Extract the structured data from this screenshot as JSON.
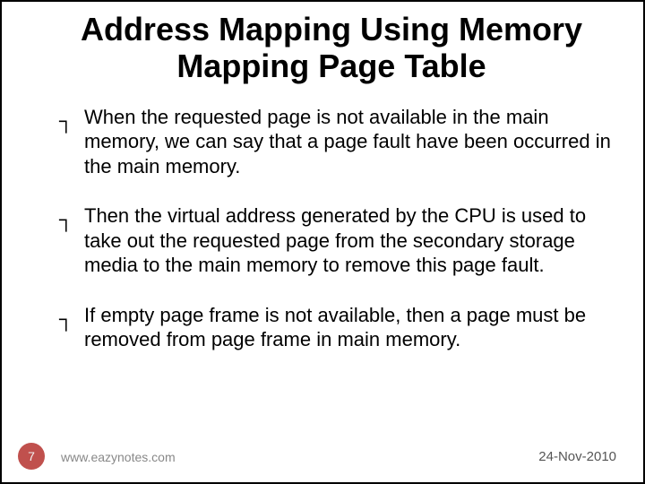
{
  "title": "Address Mapping Using Memory Mapping Page Table",
  "bullet_glyph": "┐",
  "bullets": [
    "When the requested page is not available in the main memory, we can say that a page fault have been occurred in the main memory.",
    "Then the virtual address generated by the CPU is used to take out the requested page from the secondary storage media to the main memory to remove this page fault.",
    "If empty page frame is not available, then a page must be removed from page frame in main memory."
  ],
  "footer": {
    "page_number": "7",
    "website": "www.eazynotes.com",
    "date": "24-Nov-2010"
  }
}
